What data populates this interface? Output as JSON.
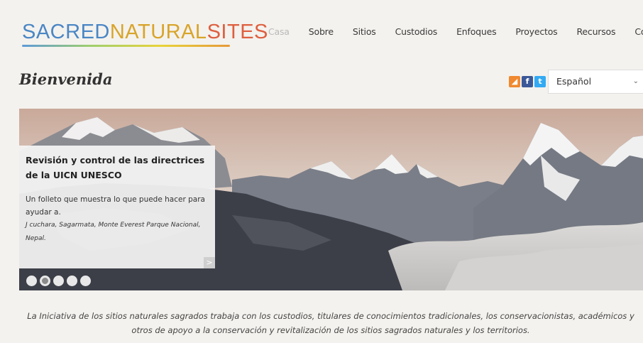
{
  "brand": {
    "logo_parts": [
      "SACRED",
      "NATURAL",
      "SITES"
    ],
    "logo_colors": [
      "#4a86c5",
      "#d8a42a",
      "#de5f3f"
    ],
    "underline_gradient": [
      "#5d9bd8",
      "#9fcf6c",
      "#e8d33a",
      "#e59a3a"
    ]
  },
  "nav": {
    "items": [
      "Casa",
      "Sobre",
      "Sitios",
      "Custodios",
      "Enfoques",
      "Proyectos",
      "Recursos",
      "Contacto"
    ],
    "active_index": 0
  },
  "page": {
    "title": "Bienvenida"
  },
  "social": [
    {
      "name": "rss-icon",
      "glyph": "◢",
      "color": "#f0892f"
    },
    {
      "name": "facebook-icon",
      "glyph": "f",
      "color": "#3b5998"
    },
    {
      "name": "twitter-icon",
      "glyph": "t",
      "color": "#33aaf3"
    }
  ],
  "language": {
    "selected": "Español",
    "chevron": "⌄"
  },
  "slider": {
    "slide_title": "Revisión y control de las directrices de la UICN UNESCO",
    "slide_description": "Un folleto que muestra lo que puede hacer para ayudar a.",
    "slide_credit": "J cuchara, Sagarmata, Monte Everest Parque Nacional, Nepal.",
    "next_glyph": ">",
    "dot_count": 5,
    "active_dot": 1
  },
  "intro": {
    "text": "La Iniciativa de los sitios naturales sagrados trabaja con los custodios, titulares de conocimientos tradicionales, los conservacionistas, académicos y otros de apoyo a la conservación y revitalización de los sitios sagrados naturales y los territorios."
  }
}
